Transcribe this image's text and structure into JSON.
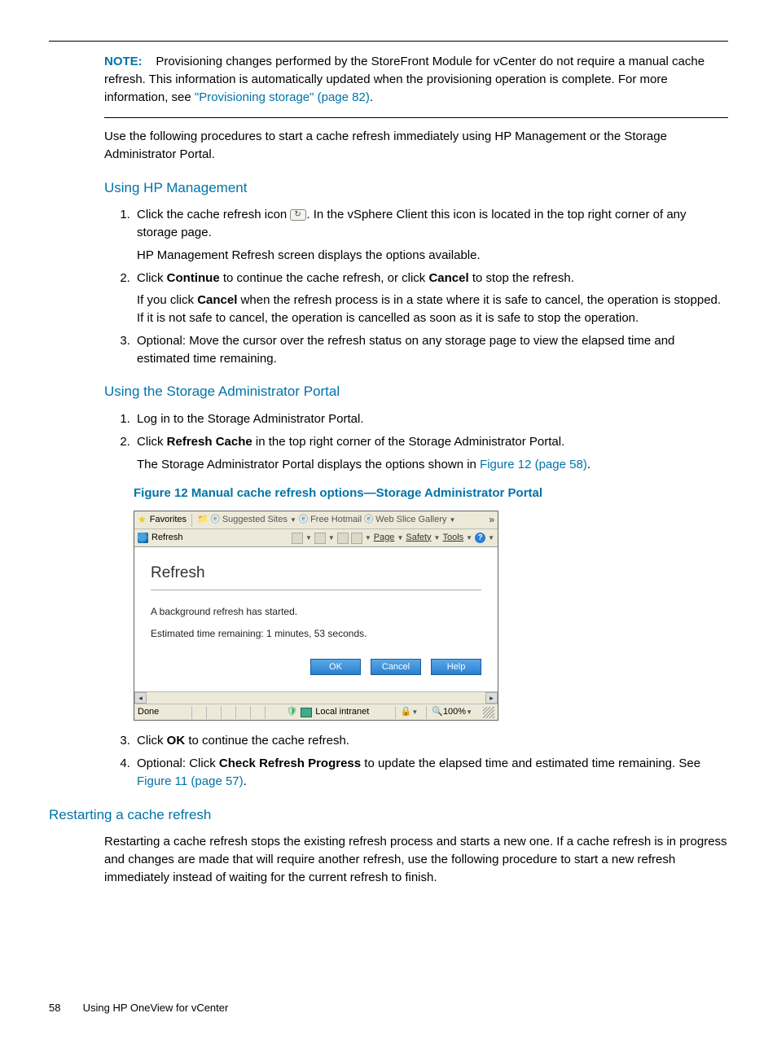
{
  "note": {
    "label": "NOTE:",
    "text": "Provisioning changes performed by the StoreFront Module for vCenter do not require a manual cache refresh. This information is automatically updated when the provisioning operation is complete. For more information, see ",
    "link": "\"Provisioning storage\" (page 82)",
    "after": "."
  },
  "intro": "Use the following procedures to start a cache refresh immediately using HP Management or the Storage Administrator Portal.",
  "sec1": {
    "title": "Using HP Management",
    "step1a": "Click the cache refresh icon ",
    "step1b": ". In the vSphere Client this icon is located in the top right corner of any storage page.",
    "step1p": "HP Management Refresh screen displays the options available.",
    "step2a": "Click ",
    "step2b": "Continue",
    "step2c": " to continue the cache refresh, or click ",
    "step2d": "Cancel",
    "step2e": " to stop the refresh.",
    "step2p1": "If you click ",
    "step2p2": "Cancel",
    "step2p3": " when the refresh process is in a state where it is safe to cancel, the operation is stopped. If it is not safe to cancel, the operation is cancelled as soon as it is safe to stop the operation.",
    "step3": "Optional: Move the cursor over the refresh status on any storage page to view the elapsed time and estimated time remaining."
  },
  "sec2": {
    "title": "Using the Storage Administrator Portal",
    "step1": "Log in to the Storage Administrator Portal.",
    "step2a": "Click ",
    "step2b": "Refresh Cache",
    "step2c": " in the top right corner of the Storage Administrator Portal.",
    "step2p1": "The Storage Administrator Portal displays the options shown in ",
    "step2link": "Figure 12 (page 58)",
    "step2p2": ".",
    "figtitle": "Figure 12 Manual cache refresh options—Storage Administrator Portal",
    "step3a": "Click ",
    "step3b": "OK",
    "step3c": " to continue the cache refresh.",
    "step4a": "Optional: Click ",
    "step4b": "Check Refresh Progress",
    "step4c": " to update the elapsed time and estimated time remaining. See ",
    "step4link": "Figure 11 (page 57)",
    "step4d": "."
  },
  "screenshot": {
    "favorites": "Favorites",
    "suggested": "Suggested Sites",
    "hotmail": "Free Hotmail",
    "webslice": "Web Slice Gallery",
    "tabRefresh": "Refresh",
    "menuPage": "Page",
    "menuSafety": "Safety",
    "menuTools": "Tools",
    "heading": "Refresh",
    "line1": "A background refresh has started.",
    "line2": "Estimated time remaining: 1 minutes, 53 seconds.",
    "btnOk": "OK",
    "btnCancel": "Cancel",
    "btnHelp": "Help",
    "statusDone": "Done",
    "statusZone": "Local intranet",
    "zoom": "100%"
  },
  "sec3": {
    "title": "Restarting a cache refresh",
    "para": "Restarting a cache refresh stops the existing refresh process and starts a new one. If a cache refresh is in progress and changes are made that will require another refresh, use the following procedure to start a new refresh immediately instead of waiting for the current refresh to finish."
  },
  "footer": {
    "page": "58",
    "title": "Using HP OneView for vCenter"
  }
}
